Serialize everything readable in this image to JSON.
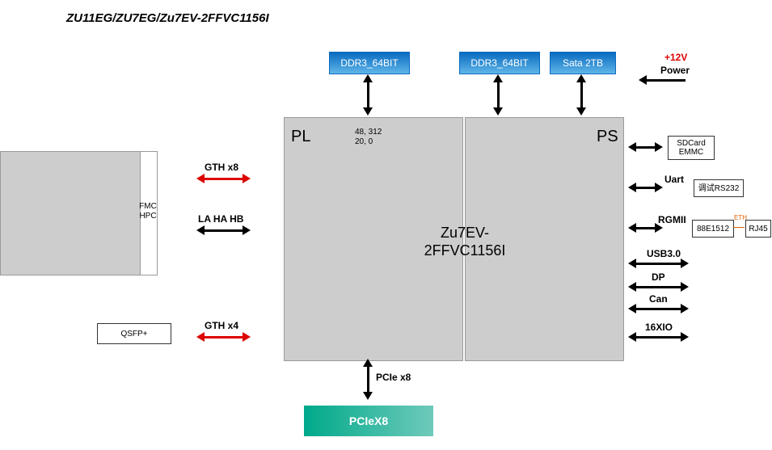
{
  "title": "ZU11EG/ZU7EG/Zu7EV-2FFVC1156I",
  "chip": {
    "pl_label": "PL",
    "ps_label": "PS",
    "center_line1": "Zu7EV-",
    "center_line2": "2FFVC1156I",
    "coords_line1": "48, 312",
    "coords_line2": "20, 0"
  },
  "top_boxes": {
    "ddr_pl": "DDR3_64BIT",
    "ddr_ps": "DDR3_64BIT",
    "sata": "Sata 2TB"
  },
  "power": {
    "volt": "+12V",
    "label": "Power"
  },
  "left": {
    "fmc_line1": "FMC",
    "fmc_line2": "HPC",
    "lahahb": "LA HA HB",
    "gth_x8": "GTH x8",
    "gth_x4": "GTH x4",
    "qsfp": "QSFP+"
  },
  "right": {
    "sdcard_line1": "SDCard",
    "sdcard_line2": "EMMC",
    "uart": "Uart",
    "rs232": "调试RS232",
    "rgmii": "RGMII",
    "phy": "88E1512",
    "eth": "ETH",
    "rj45": "RJ45",
    "usb": "USB3.0",
    "dp": "DP",
    "can": "Can",
    "xio": "16XIO"
  },
  "bottom": {
    "pcie_label": "PCIe x8",
    "pcie_box": "PCIeX8"
  }
}
